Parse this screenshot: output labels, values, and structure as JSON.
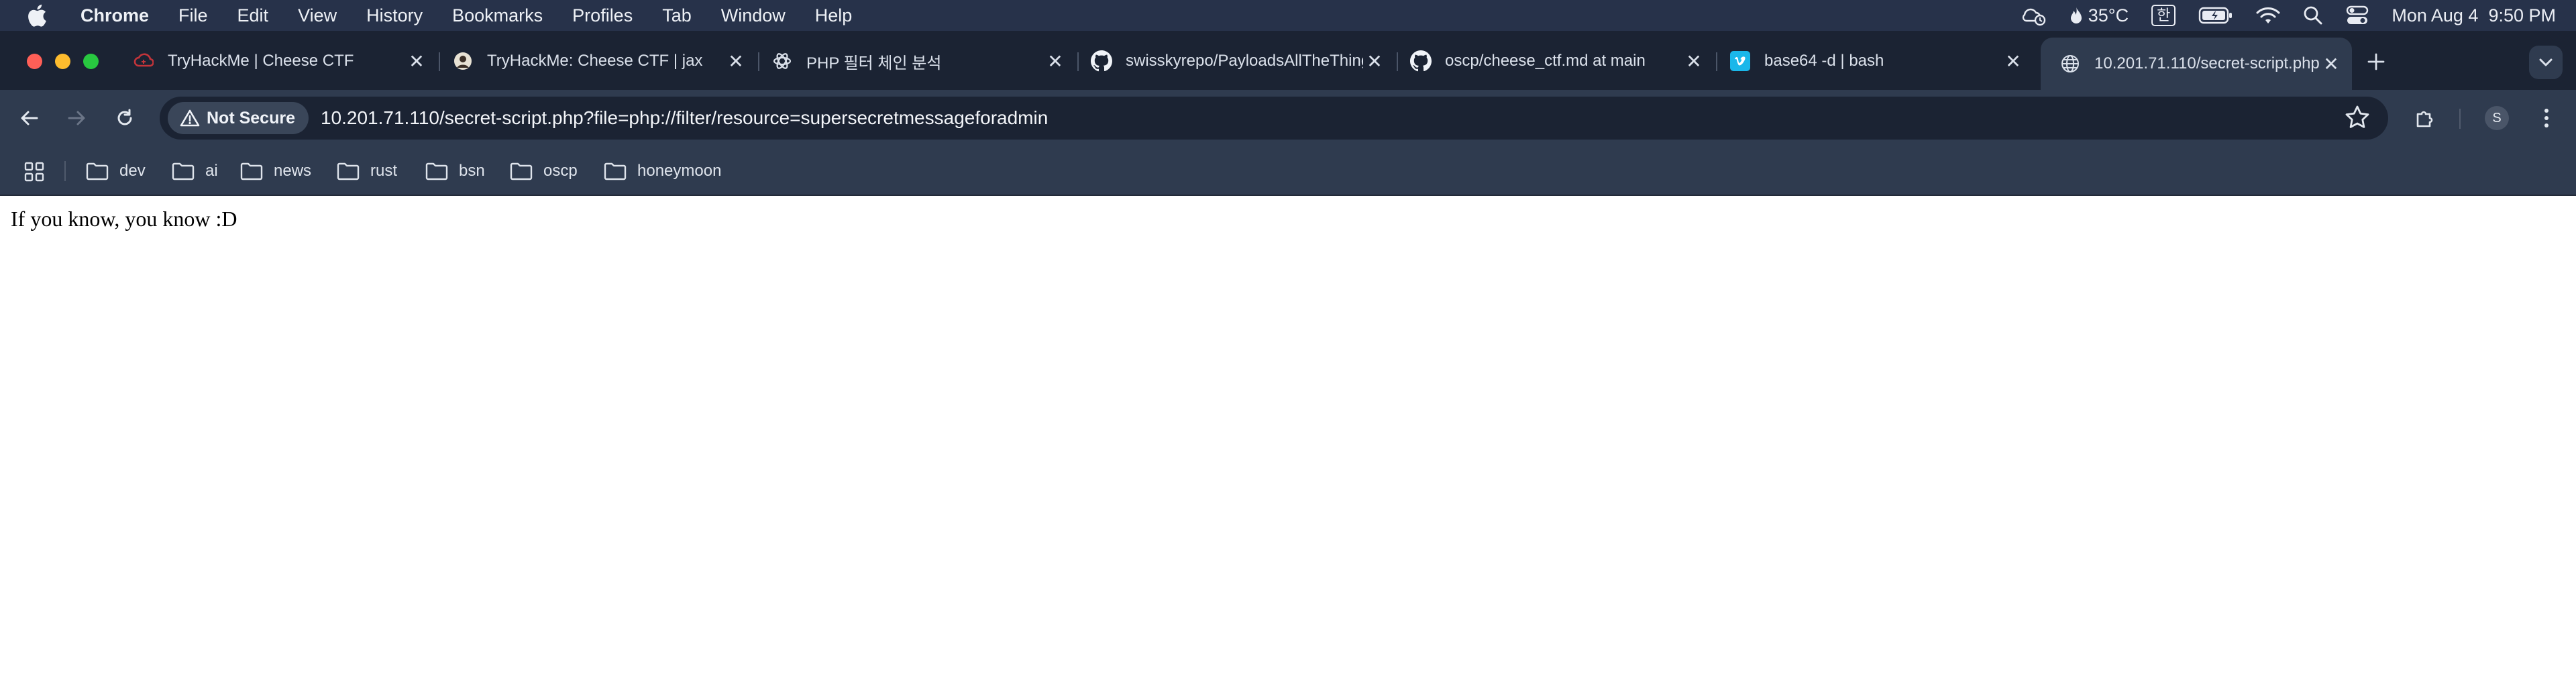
{
  "menubar": {
    "app_name": "Chrome",
    "menus": [
      "File",
      "Edit",
      "View",
      "History",
      "Bookmarks",
      "Profiles",
      "Tab",
      "Window",
      "Help"
    ],
    "weather": "35°C",
    "input_method": "한",
    "datetime": "Mon Aug 4  9:50 PM"
  },
  "tabs": [
    {
      "title": "TryHackMe | Cheese CTF",
      "icon": "tryhackme-icon"
    },
    {
      "title": "TryHackMe: Cheese CTF | jax",
      "icon": "jaxafed-avatar-icon"
    },
    {
      "title": "PHP 필터 체인 분석",
      "icon": "openai-icon"
    },
    {
      "title": "swisskyrepo/PayloadsAllTheThings",
      "icon": "github-icon"
    },
    {
      "title": "oscp/cheese_ctf.md at main",
      "icon": "github-icon"
    },
    {
      "title": "base64 -d | bash",
      "icon": "vimeo-icon"
    },
    {
      "title": "10.201.71.110/secret-script.php",
      "icon": "globe-icon"
    }
  ],
  "toolbar": {
    "security_label": "Not Secure",
    "url": "10.201.71.110/secret-script.php?file=php://filter/resource=supersecretmessageforadmin",
    "profile_initial": "S"
  },
  "bookmarks": [
    "dev",
    "ai",
    "news",
    "rust",
    "bsn",
    "oscp",
    "honeymoon"
  ],
  "page": {
    "text": "If you know, you know :D"
  },
  "colors": {
    "menubar_bg": "#27324a",
    "tabstrip_bg": "#1b2333",
    "toolbar_bg": "#2f3b4f",
    "close_red": "#ff5f57",
    "minimize_yellow": "#febc2e",
    "zoom_green": "#28c840"
  }
}
